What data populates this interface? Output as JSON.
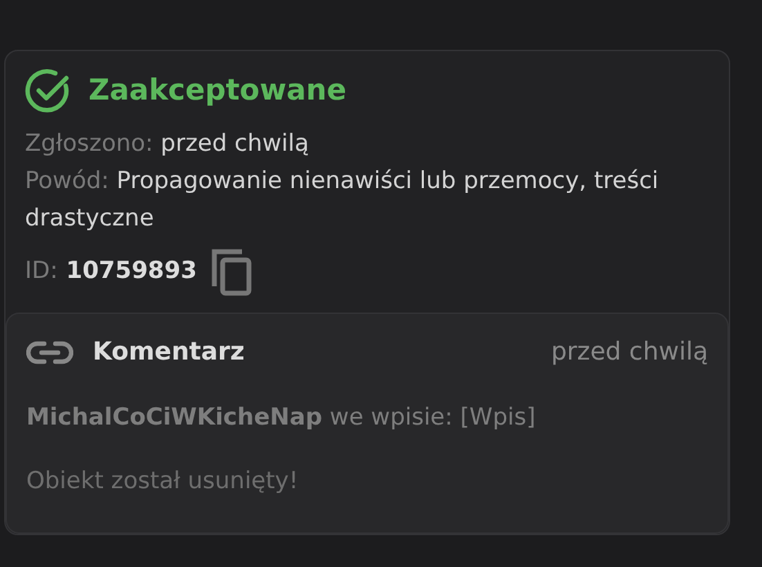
{
  "report": {
    "status": {
      "text": "Zaakceptowane",
      "kind": "accepted"
    },
    "fields": [
      {
        "label": "Zgłoszono:",
        "value": "przed chwilą"
      },
      {
        "label": "Powód:",
        "value": "Propagowanie nienawiści lub przemocy, treści drastyczne"
      }
    ],
    "id": {
      "label": "ID:",
      "value": "10759893"
    }
  },
  "item": {
    "kind": "comment",
    "title": "Komentarz",
    "time": "przed chwilą",
    "author": "MichalCoCiWKicheNap",
    "context": "we wpisie: [Wpis]",
    "body": "Obiekt został usunięty!"
  }
}
